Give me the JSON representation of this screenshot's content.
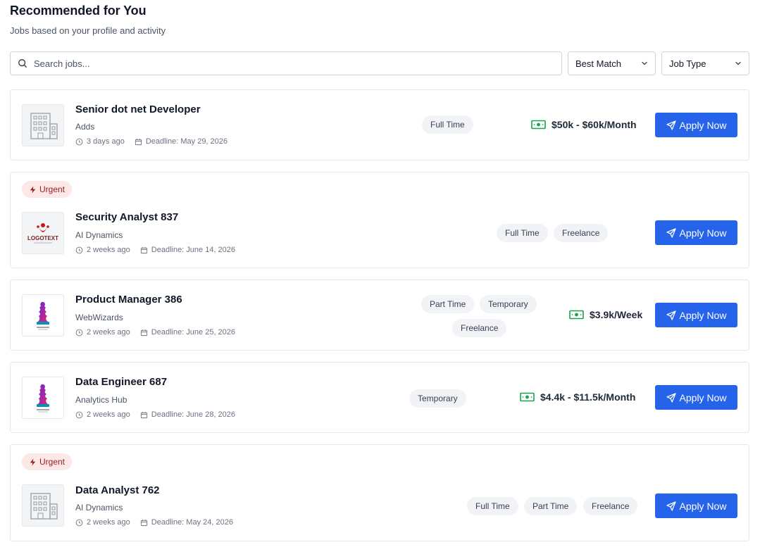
{
  "header": {
    "title": "Recommended for You",
    "subtitle": "Jobs based on your profile and activity"
  },
  "filters": {
    "search_placeholder": "Search jobs...",
    "sort_value": "Best Match",
    "type_value": "Job Type"
  },
  "colors": {
    "primary": "#2563eb",
    "salary_icon": "#16a34a",
    "urgent_bg": "#fde8e8",
    "urgent_text": "#991b1b"
  },
  "jobs": [
    {
      "title": "Senior dot net Developer",
      "company": "Adds",
      "posted": "3 days ago",
      "deadline": "Deadline: May 29, 2026",
      "tags": [
        "Full Time"
      ],
      "salary": "$50k  -  $60k/Month",
      "urgent": "",
      "logo": "building-icon",
      "apply_label": "Apply Now"
    },
    {
      "title": "Security Analyst 837",
      "company": "AI Dynamics",
      "posted": "2 weeks ago",
      "deadline": "Deadline: June 14, 2026",
      "tags": [
        "Full Time",
        "Freelance"
      ],
      "salary": "",
      "urgent": "Urgent",
      "logo": "logotext-logo",
      "logo_text": "LOGOTEXT",
      "apply_label": "Apply Now"
    },
    {
      "title": "Product Manager 386",
      "company": "WebWizards",
      "posted": "2 weeks ago",
      "deadline": "Deadline: June 25, 2026",
      "tags": [
        "Part Time",
        "Temporary",
        "Freelance"
      ],
      "salary": "$3.9k/Week",
      "urgent": "",
      "logo": "chess-piece-logo",
      "apply_label": "Apply Now"
    },
    {
      "title": "Data Engineer 687",
      "company": "Analytics Hub",
      "posted": "2 weeks ago",
      "deadline": "Deadline: June 28, 2026",
      "tags": [
        "Temporary"
      ],
      "salary": "$4.4k  -  $11.5k/Month",
      "urgent": "",
      "logo": "chess-piece-logo",
      "apply_label": "Apply Now"
    },
    {
      "title": "Data Analyst 762",
      "company": "AI Dynamics",
      "posted": "2 weeks ago",
      "deadline": "Deadline: May 24, 2026",
      "tags": [
        "Full Time",
        "Part Time",
        "Freelance"
      ],
      "salary": "",
      "urgent": "Urgent",
      "logo": "building-icon",
      "apply_label": "Apply Now"
    }
  ]
}
